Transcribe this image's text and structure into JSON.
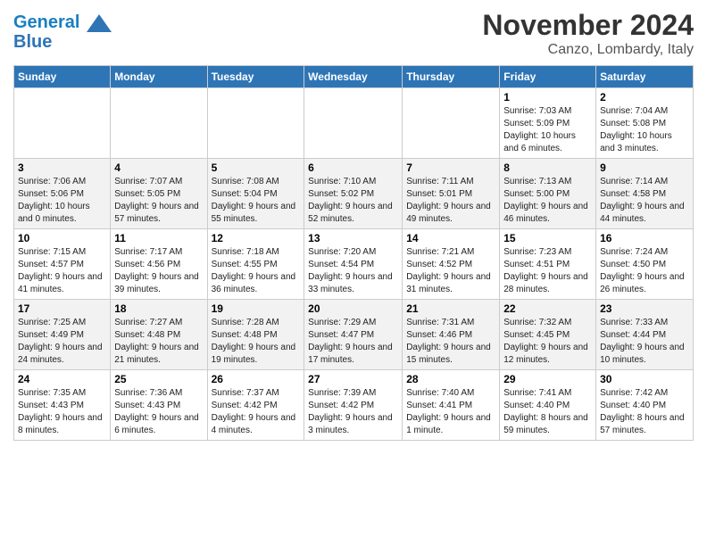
{
  "header": {
    "logo_line1": "General",
    "logo_line2": "Blue",
    "title": "November 2024",
    "location": "Canzo, Lombardy, Italy"
  },
  "days_of_week": [
    "Sunday",
    "Monday",
    "Tuesday",
    "Wednesday",
    "Thursday",
    "Friday",
    "Saturday"
  ],
  "weeks": [
    [
      {
        "day": "",
        "info": ""
      },
      {
        "day": "",
        "info": ""
      },
      {
        "day": "",
        "info": ""
      },
      {
        "day": "",
        "info": ""
      },
      {
        "day": "",
        "info": ""
      },
      {
        "day": "1",
        "info": "Sunrise: 7:03 AM\nSunset: 5:09 PM\nDaylight: 10 hours and 6 minutes."
      },
      {
        "day": "2",
        "info": "Sunrise: 7:04 AM\nSunset: 5:08 PM\nDaylight: 10 hours and 3 minutes."
      }
    ],
    [
      {
        "day": "3",
        "info": "Sunrise: 7:06 AM\nSunset: 5:06 PM\nDaylight: 10 hours and 0 minutes."
      },
      {
        "day": "4",
        "info": "Sunrise: 7:07 AM\nSunset: 5:05 PM\nDaylight: 9 hours and 57 minutes."
      },
      {
        "day": "5",
        "info": "Sunrise: 7:08 AM\nSunset: 5:04 PM\nDaylight: 9 hours and 55 minutes."
      },
      {
        "day": "6",
        "info": "Sunrise: 7:10 AM\nSunset: 5:02 PM\nDaylight: 9 hours and 52 minutes."
      },
      {
        "day": "7",
        "info": "Sunrise: 7:11 AM\nSunset: 5:01 PM\nDaylight: 9 hours and 49 minutes."
      },
      {
        "day": "8",
        "info": "Sunrise: 7:13 AM\nSunset: 5:00 PM\nDaylight: 9 hours and 46 minutes."
      },
      {
        "day": "9",
        "info": "Sunrise: 7:14 AM\nSunset: 4:58 PM\nDaylight: 9 hours and 44 minutes."
      }
    ],
    [
      {
        "day": "10",
        "info": "Sunrise: 7:15 AM\nSunset: 4:57 PM\nDaylight: 9 hours and 41 minutes."
      },
      {
        "day": "11",
        "info": "Sunrise: 7:17 AM\nSunset: 4:56 PM\nDaylight: 9 hours and 39 minutes."
      },
      {
        "day": "12",
        "info": "Sunrise: 7:18 AM\nSunset: 4:55 PM\nDaylight: 9 hours and 36 minutes."
      },
      {
        "day": "13",
        "info": "Sunrise: 7:20 AM\nSunset: 4:54 PM\nDaylight: 9 hours and 33 minutes."
      },
      {
        "day": "14",
        "info": "Sunrise: 7:21 AM\nSunset: 4:52 PM\nDaylight: 9 hours and 31 minutes."
      },
      {
        "day": "15",
        "info": "Sunrise: 7:23 AM\nSunset: 4:51 PM\nDaylight: 9 hours and 28 minutes."
      },
      {
        "day": "16",
        "info": "Sunrise: 7:24 AM\nSunset: 4:50 PM\nDaylight: 9 hours and 26 minutes."
      }
    ],
    [
      {
        "day": "17",
        "info": "Sunrise: 7:25 AM\nSunset: 4:49 PM\nDaylight: 9 hours and 24 minutes."
      },
      {
        "day": "18",
        "info": "Sunrise: 7:27 AM\nSunset: 4:48 PM\nDaylight: 9 hours and 21 minutes."
      },
      {
        "day": "19",
        "info": "Sunrise: 7:28 AM\nSunset: 4:48 PM\nDaylight: 9 hours and 19 minutes."
      },
      {
        "day": "20",
        "info": "Sunrise: 7:29 AM\nSunset: 4:47 PM\nDaylight: 9 hours and 17 minutes."
      },
      {
        "day": "21",
        "info": "Sunrise: 7:31 AM\nSunset: 4:46 PM\nDaylight: 9 hours and 15 minutes."
      },
      {
        "day": "22",
        "info": "Sunrise: 7:32 AM\nSunset: 4:45 PM\nDaylight: 9 hours and 12 minutes."
      },
      {
        "day": "23",
        "info": "Sunrise: 7:33 AM\nSunset: 4:44 PM\nDaylight: 9 hours and 10 minutes."
      }
    ],
    [
      {
        "day": "24",
        "info": "Sunrise: 7:35 AM\nSunset: 4:43 PM\nDaylight: 9 hours and 8 minutes."
      },
      {
        "day": "25",
        "info": "Sunrise: 7:36 AM\nSunset: 4:43 PM\nDaylight: 9 hours and 6 minutes."
      },
      {
        "day": "26",
        "info": "Sunrise: 7:37 AM\nSunset: 4:42 PM\nDaylight: 9 hours and 4 minutes."
      },
      {
        "day": "27",
        "info": "Sunrise: 7:39 AM\nSunset: 4:42 PM\nDaylight: 9 hours and 3 minutes."
      },
      {
        "day": "28",
        "info": "Sunrise: 7:40 AM\nSunset: 4:41 PM\nDaylight: 9 hours and 1 minute."
      },
      {
        "day": "29",
        "info": "Sunrise: 7:41 AM\nSunset: 4:40 PM\nDaylight: 8 hours and 59 minutes."
      },
      {
        "day": "30",
        "info": "Sunrise: 7:42 AM\nSunset: 4:40 PM\nDaylight: 8 hours and 57 minutes."
      }
    ]
  ]
}
